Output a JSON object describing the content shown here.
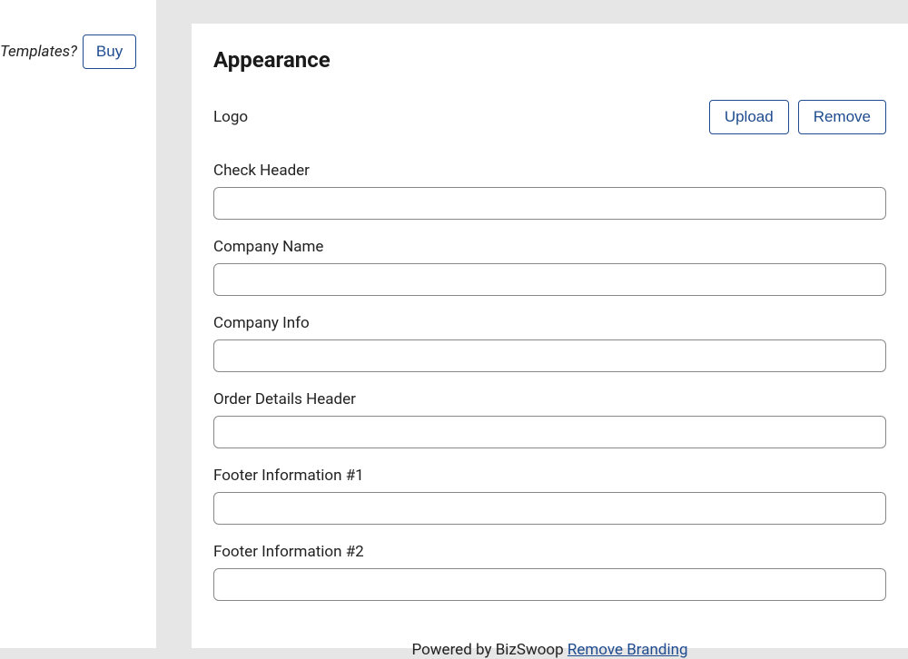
{
  "sidebar": {
    "templates_text": "Templates?",
    "buy_label": "Buy"
  },
  "page_title": "Appearance",
  "logo": {
    "label": "Logo",
    "upload_label": "Upload",
    "remove_label": "Remove"
  },
  "fields": {
    "check_header": {
      "label": "Check Header",
      "value": ""
    },
    "company_name": {
      "label": "Company Name",
      "value": ""
    },
    "company_info": {
      "label": "Company Info",
      "value": ""
    },
    "order_details_header": {
      "label": "Order Details Header",
      "value": ""
    },
    "footer_info_1": {
      "label": "Footer Information #1",
      "value": ""
    },
    "footer_info_2": {
      "label": "Footer Information #2",
      "value": ""
    }
  },
  "footer": {
    "powered_by": "Powered by BizSwoop ",
    "remove_branding": "Remove Branding"
  }
}
